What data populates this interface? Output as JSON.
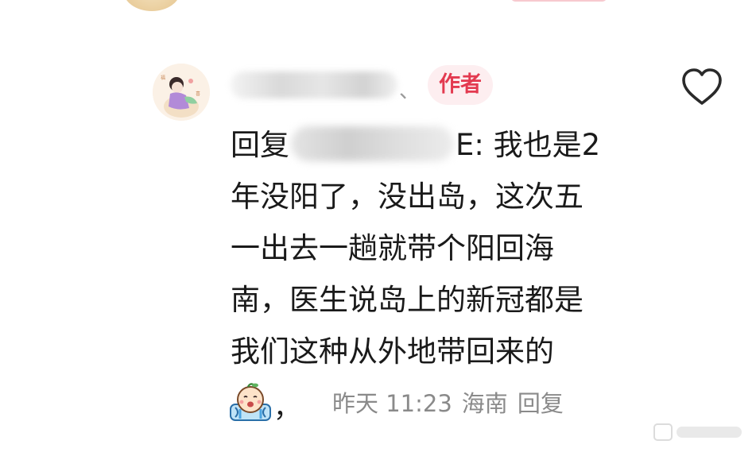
{
  "comment": {
    "author_tag": "作者",
    "name_separator": "、",
    "reply_prefix": "回复",
    "reply_suffix_visible": "E: 我也是2",
    "lines": [
      "年没阳了，没出岛，这次五",
      "一出去一趟就带个阳回海",
      "南，医生说岛上的新冠都是",
      "我们这种从外地带回来的"
    ],
    "trailing_comma": "，",
    "meta": {
      "time": "昨天 11:23",
      "location": "海南",
      "reply": "回复"
    }
  },
  "icons": {
    "like": "heart-outline-icon",
    "emoji": "crying-face-emoji-icon",
    "watermark": "watermark-icon"
  },
  "colors": {
    "author_tag_bg": "#fdeef0",
    "author_tag_text": "#e33a50",
    "meta_text": "#8a8a8a",
    "body_text": "#1a1a1a"
  }
}
